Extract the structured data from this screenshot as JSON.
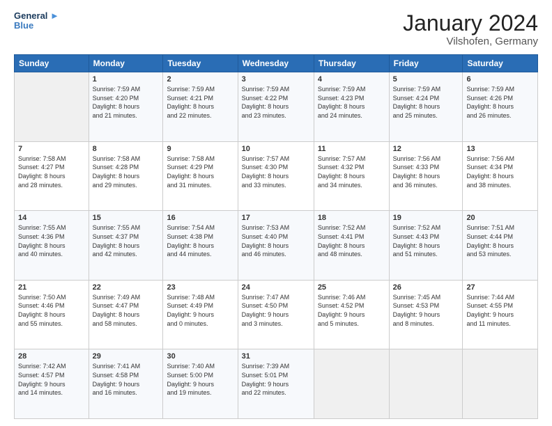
{
  "logo": {
    "line1": "General",
    "line2": "Blue"
  },
  "title": "January 2024",
  "location": "Vilshofen, Germany",
  "weekdays": [
    "Sunday",
    "Monday",
    "Tuesday",
    "Wednesday",
    "Thursday",
    "Friday",
    "Saturday"
  ],
  "weeks": [
    [
      {
        "day": "",
        "info": ""
      },
      {
        "day": "1",
        "info": "Sunrise: 7:59 AM\nSunset: 4:20 PM\nDaylight: 8 hours\nand 21 minutes."
      },
      {
        "day": "2",
        "info": "Sunrise: 7:59 AM\nSunset: 4:21 PM\nDaylight: 8 hours\nand 22 minutes."
      },
      {
        "day": "3",
        "info": "Sunrise: 7:59 AM\nSunset: 4:22 PM\nDaylight: 8 hours\nand 23 minutes."
      },
      {
        "day": "4",
        "info": "Sunrise: 7:59 AM\nSunset: 4:23 PM\nDaylight: 8 hours\nand 24 minutes."
      },
      {
        "day": "5",
        "info": "Sunrise: 7:59 AM\nSunset: 4:24 PM\nDaylight: 8 hours\nand 25 minutes."
      },
      {
        "day": "6",
        "info": "Sunrise: 7:59 AM\nSunset: 4:26 PM\nDaylight: 8 hours\nand 26 minutes."
      }
    ],
    [
      {
        "day": "7",
        "info": "Sunrise: 7:58 AM\nSunset: 4:27 PM\nDaylight: 8 hours\nand 28 minutes."
      },
      {
        "day": "8",
        "info": "Sunrise: 7:58 AM\nSunset: 4:28 PM\nDaylight: 8 hours\nand 29 minutes."
      },
      {
        "day": "9",
        "info": "Sunrise: 7:58 AM\nSunset: 4:29 PM\nDaylight: 8 hours\nand 31 minutes."
      },
      {
        "day": "10",
        "info": "Sunrise: 7:57 AM\nSunset: 4:30 PM\nDaylight: 8 hours\nand 33 minutes."
      },
      {
        "day": "11",
        "info": "Sunrise: 7:57 AM\nSunset: 4:32 PM\nDaylight: 8 hours\nand 34 minutes."
      },
      {
        "day": "12",
        "info": "Sunrise: 7:56 AM\nSunset: 4:33 PM\nDaylight: 8 hours\nand 36 minutes."
      },
      {
        "day": "13",
        "info": "Sunrise: 7:56 AM\nSunset: 4:34 PM\nDaylight: 8 hours\nand 38 minutes."
      }
    ],
    [
      {
        "day": "14",
        "info": "Sunrise: 7:55 AM\nSunset: 4:36 PM\nDaylight: 8 hours\nand 40 minutes."
      },
      {
        "day": "15",
        "info": "Sunrise: 7:55 AM\nSunset: 4:37 PM\nDaylight: 8 hours\nand 42 minutes."
      },
      {
        "day": "16",
        "info": "Sunrise: 7:54 AM\nSunset: 4:38 PM\nDaylight: 8 hours\nand 44 minutes."
      },
      {
        "day": "17",
        "info": "Sunrise: 7:53 AM\nSunset: 4:40 PM\nDaylight: 8 hours\nand 46 minutes."
      },
      {
        "day": "18",
        "info": "Sunrise: 7:52 AM\nSunset: 4:41 PM\nDaylight: 8 hours\nand 48 minutes."
      },
      {
        "day": "19",
        "info": "Sunrise: 7:52 AM\nSunset: 4:43 PM\nDaylight: 8 hours\nand 51 minutes."
      },
      {
        "day": "20",
        "info": "Sunrise: 7:51 AM\nSunset: 4:44 PM\nDaylight: 8 hours\nand 53 minutes."
      }
    ],
    [
      {
        "day": "21",
        "info": "Sunrise: 7:50 AM\nSunset: 4:46 PM\nDaylight: 8 hours\nand 55 minutes."
      },
      {
        "day": "22",
        "info": "Sunrise: 7:49 AM\nSunset: 4:47 PM\nDaylight: 8 hours\nand 58 minutes."
      },
      {
        "day": "23",
        "info": "Sunrise: 7:48 AM\nSunset: 4:49 PM\nDaylight: 9 hours\nand 0 minutes."
      },
      {
        "day": "24",
        "info": "Sunrise: 7:47 AM\nSunset: 4:50 PM\nDaylight: 9 hours\nand 3 minutes."
      },
      {
        "day": "25",
        "info": "Sunrise: 7:46 AM\nSunset: 4:52 PM\nDaylight: 9 hours\nand 5 minutes."
      },
      {
        "day": "26",
        "info": "Sunrise: 7:45 AM\nSunset: 4:53 PM\nDaylight: 9 hours\nand 8 minutes."
      },
      {
        "day": "27",
        "info": "Sunrise: 7:44 AM\nSunset: 4:55 PM\nDaylight: 9 hours\nand 11 minutes."
      }
    ],
    [
      {
        "day": "28",
        "info": "Sunrise: 7:42 AM\nSunset: 4:57 PM\nDaylight: 9 hours\nand 14 minutes."
      },
      {
        "day": "29",
        "info": "Sunrise: 7:41 AM\nSunset: 4:58 PM\nDaylight: 9 hours\nand 16 minutes."
      },
      {
        "day": "30",
        "info": "Sunrise: 7:40 AM\nSunset: 5:00 PM\nDaylight: 9 hours\nand 19 minutes."
      },
      {
        "day": "31",
        "info": "Sunrise: 7:39 AM\nSunset: 5:01 PM\nDaylight: 9 hours\nand 22 minutes."
      },
      {
        "day": "",
        "info": ""
      },
      {
        "day": "",
        "info": ""
      },
      {
        "day": "",
        "info": ""
      }
    ]
  ]
}
